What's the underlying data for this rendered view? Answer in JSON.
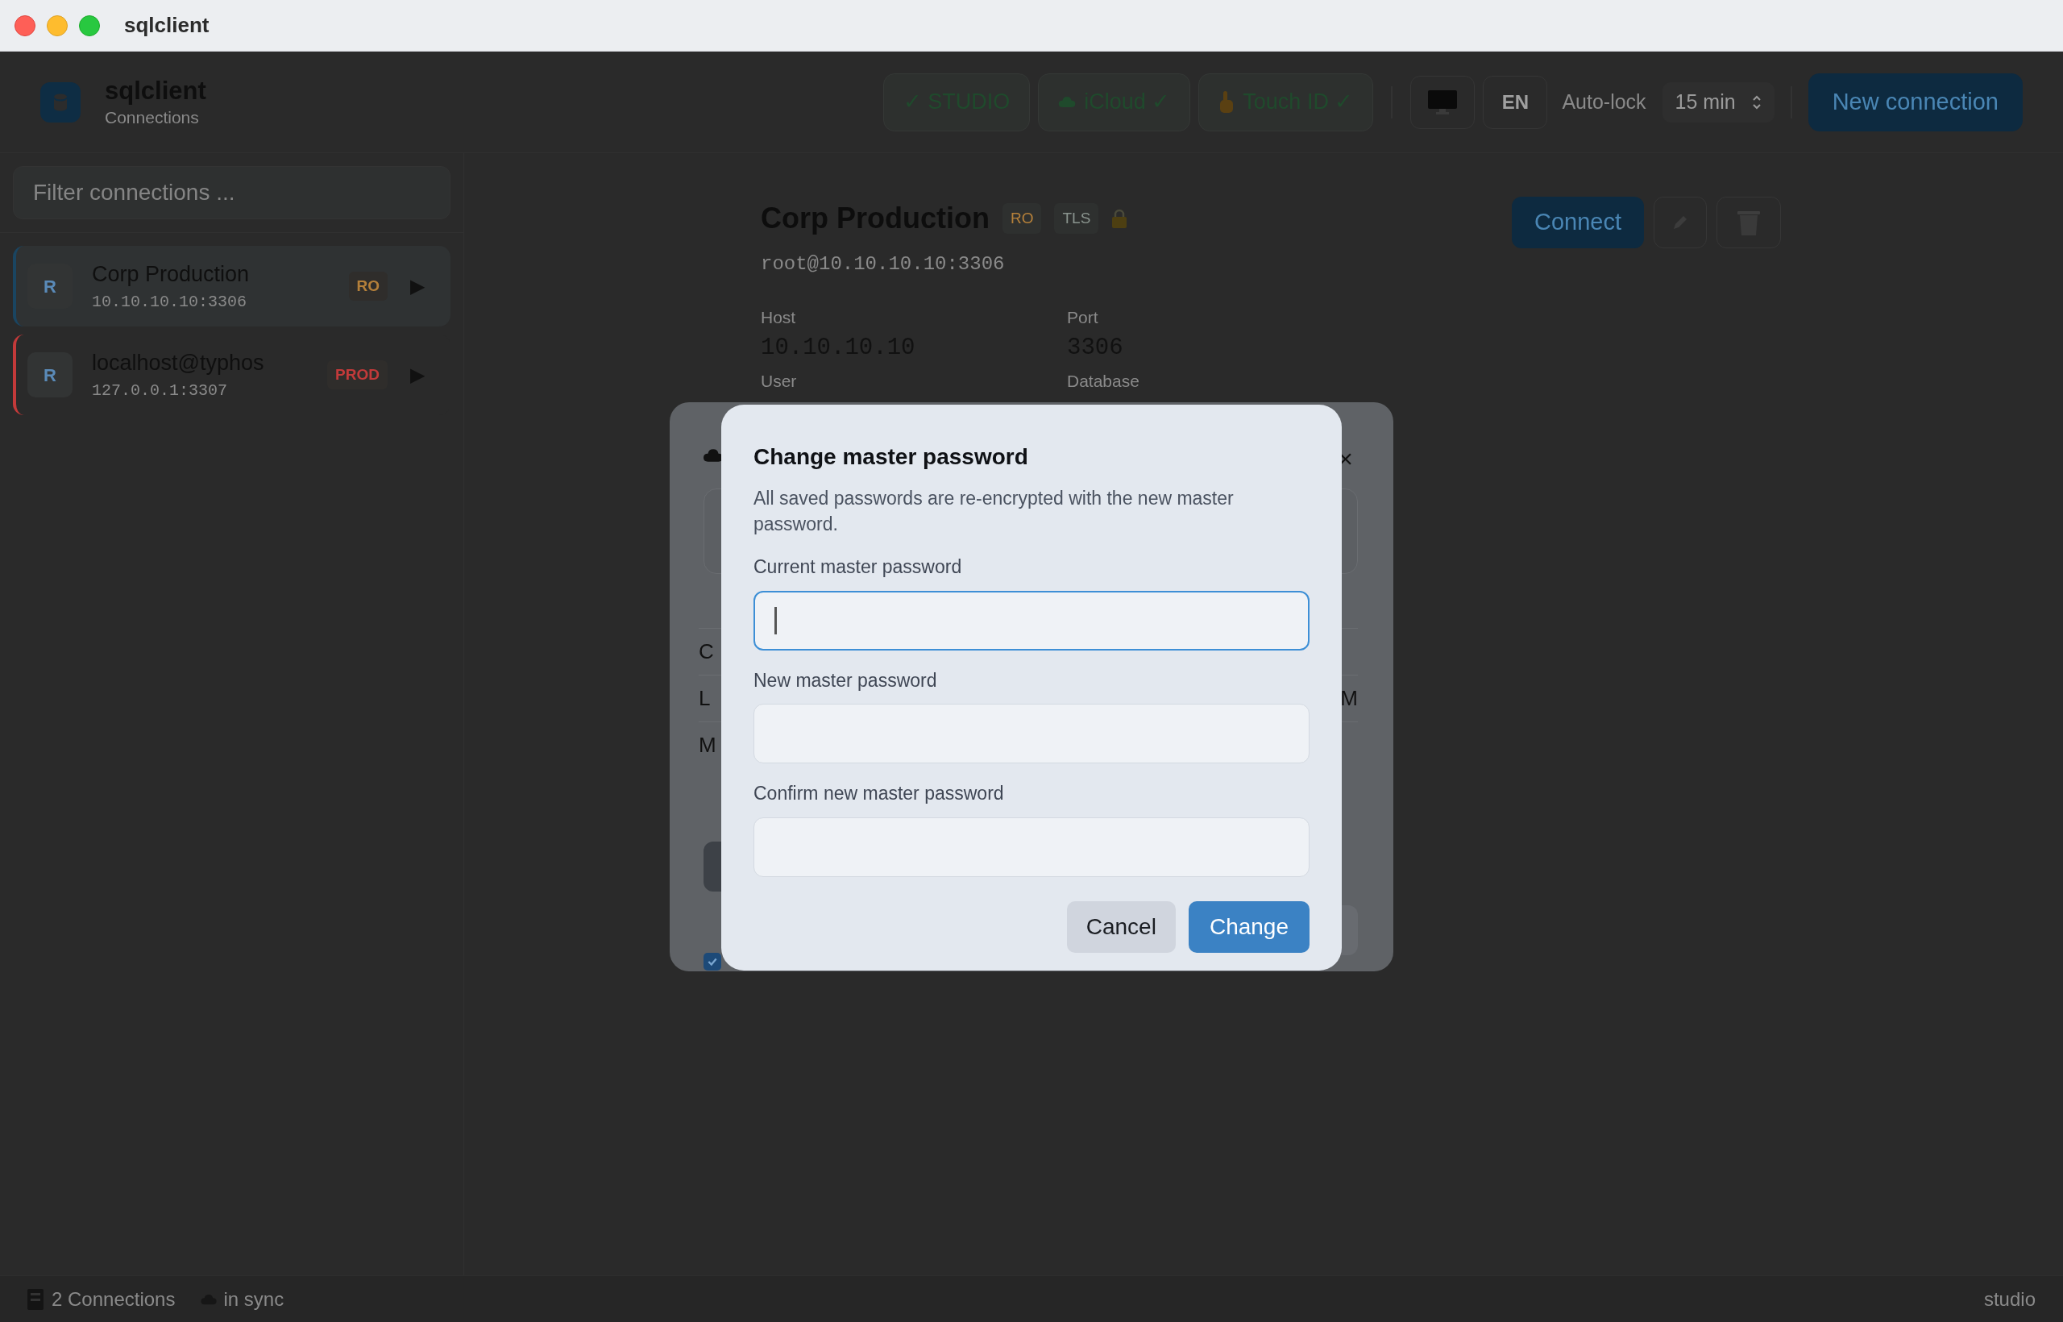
{
  "window": {
    "title": "sqlclient"
  },
  "header": {
    "app_name": "sqlclient",
    "subtitle": "Connections",
    "chips": [
      {
        "kind": "text",
        "label": "✓ STUDIO"
      },
      {
        "kind": "cloud",
        "label": "iCloud ✓"
      },
      {
        "kind": "touch",
        "label": "Touch ID ✓"
      }
    ],
    "language": "EN",
    "auto_lock": {
      "label": "Auto-lock",
      "value": "15 min"
    },
    "new_button": "New connection"
  },
  "sidebar": {
    "filter_placeholder": "Filter connections ...",
    "connections": [
      {
        "initial": "R",
        "name": "Corp Production",
        "address": "10.10.10.10:3306",
        "badge": "RO",
        "action": "▶",
        "color": "#b5803a",
        "selected": true
      },
      {
        "initial": "R",
        "name": "localhost@typhos",
        "address": "127.0.0.1:3307",
        "badge": "PROD",
        "action": "▶",
        "color": "#c33a3a",
        "selected": false
      }
    ]
  },
  "detail": {
    "title": "Corp Production",
    "badges": [
      {
        "label": "RO",
        "color": "#b5803a"
      },
      {
        "label": "TLS",
        "color": "#8a948e"
      }
    ],
    "connection_string": "root@10.10.10.10:3306",
    "fields": [
      {
        "label": "Host",
        "value": "10.10.10.10"
      },
      {
        "label": "Port",
        "value": "3306"
      },
      {
        "label": "User"
      },
      {
        "label": "Database"
      }
    ],
    "connect_button": "Connect"
  },
  "back_dialog": {
    "close": "×",
    "rows": [
      {
        "label": "C"
      },
      {
        "label": "L",
        "value": "M"
      },
      {
        "label": "M"
      }
    ],
    "checkbox_checked": true
  },
  "dialog": {
    "title": "Change master password",
    "description": "All saved passwords are re-encrypted with the new master password.",
    "fields": [
      {
        "label": "Current master password",
        "focused": true
      },
      {
        "label": "New master password",
        "focused": false
      },
      {
        "label": "Confirm new master password",
        "focused": false
      }
    ],
    "cancel": "Cancel",
    "confirm": "Change"
  },
  "status_bar": {
    "connections": "2 Connections",
    "sync": "in sync",
    "profile": "studio"
  }
}
